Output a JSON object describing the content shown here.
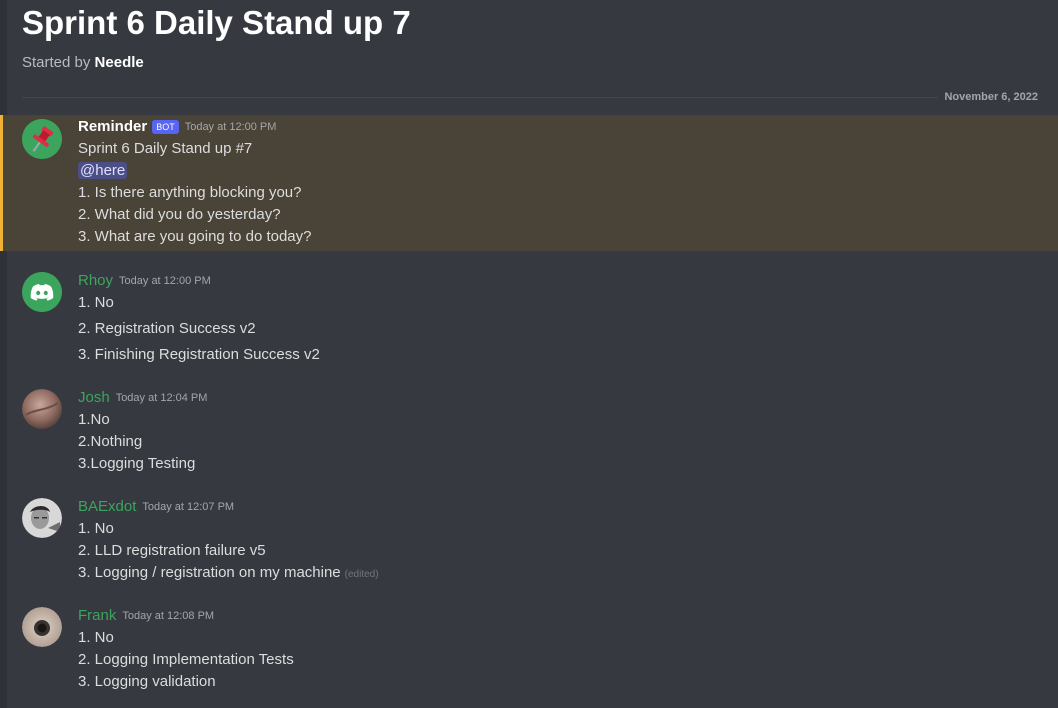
{
  "thread": {
    "title": "Sprint 6 Daily Stand up 7",
    "started_by_prefix": "Started by",
    "started_by_author": "Needle"
  },
  "date_divider": "November 6, 2022",
  "messages": [
    {
      "author": "Reminder",
      "bot_tag": "BOT",
      "timestamp": "Today at 12:00 PM",
      "line1": "Sprint 6 Daily Stand up #7",
      "mention": "@here",
      "line3": "1. Is there anything blocking you?",
      "line4": "2. What did you do yesterday?",
      "line5": "3. What are you going to do today?"
    },
    {
      "author": "Rhoy",
      "timestamp": "Today at 12:00 PM",
      "line1": "1. No",
      "line2": "2. Registration Success v2",
      "line3": "3. Finishing Registration Success v2"
    },
    {
      "author": "Josh",
      "timestamp": "Today at 12:04 PM",
      "line1": "1.No",
      "line2": "2.Nothing",
      "line3": "3.Logging Testing"
    },
    {
      "author": "BAExdot",
      "timestamp": "Today at 12:07 PM",
      "line1": "1. No",
      "line2": "2. LLD registration failure v5",
      "line3": "3. Logging / registration on my machine",
      "edited": "(edited)"
    },
    {
      "author": "Frank",
      "timestamp": "Today at 12:08 PM",
      "line1": "1. No",
      "line2": "2. Logging Implementation Tests",
      "line3": "3. Logging validation"
    }
  ],
  "colors": {
    "background": "#36393f",
    "highlight": "#4a4337",
    "highlight_border": "#f0b232",
    "username_green": "#3ba55d",
    "bot_tag": "#5865f2",
    "discord_avatar": "#3ba55d"
  }
}
